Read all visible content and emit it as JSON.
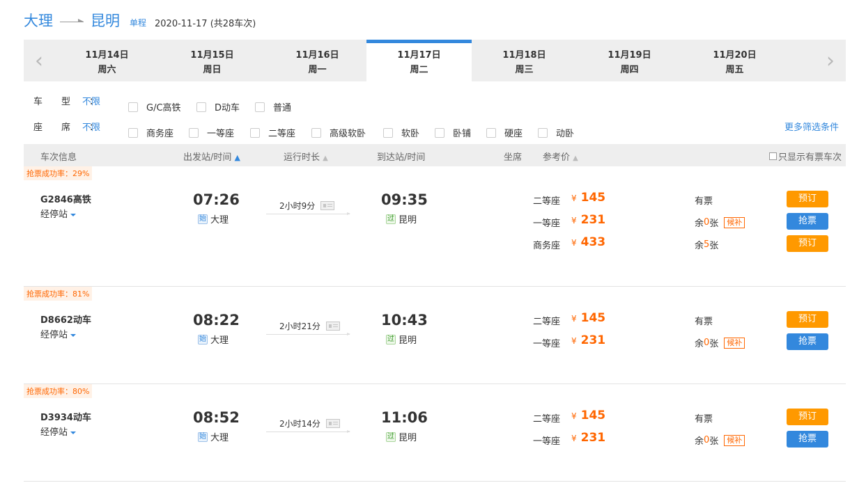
{
  "route": {
    "from": "大理",
    "to": "昆明",
    "trip_type": "单程",
    "date_summary": "2020-11-17 (共28车次)"
  },
  "date_tabs": [
    {
      "date": "11月14日",
      "weekday": "周六"
    },
    {
      "date": "11月15日",
      "weekday": "周日"
    },
    {
      "date": "11月16日",
      "weekday": "周一"
    },
    {
      "date": "11月17日",
      "weekday": "周二"
    },
    {
      "date": "11月18日",
      "weekday": "周三"
    },
    {
      "date": "11月19日",
      "weekday": "周四"
    },
    {
      "date": "11月20日",
      "weekday": "周五"
    }
  ],
  "active_tab": 3,
  "nav": {
    "prev": "‹",
    "next": "›"
  },
  "filters": {
    "train_type_label": "车型：",
    "seat_label": "座席：",
    "any": "不限",
    "train_types": [
      "G/C高铁",
      "D动车",
      "普通"
    ],
    "seats": [
      "商务座",
      "一等座",
      "二等座",
      "高级软卧",
      "软卧",
      "卧铺",
      "硬座",
      "动卧"
    ],
    "more": "更多筛选条件"
  },
  "table_header": {
    "train_info": "车次信息",
    "depart": "出发站/时间",
    "duration": "运行时长",
    "arrive": "到达站/时间",
    "seat": "坐席",
    "price": "参考价",
    "only_available": "只显示有票车次"
  },
  "labels": {
    "stops": "经停站",
    "start_tag": "始",
    "pass_tag": "过",
    "book": "预订",
    "grab": "抢票",
    "waitlist": "候补",
    "yen": "¥"
  },
  "trains": [
    {
      "rate": "抢票成功率：29%",
      "code": "G2846高铁",
      "depart_time": "07:26",
      "depart_station": "大理",
      "duration": "2小时9分",
      "arrive_time": "09:35",
      "arrive_station": "昆明",
      "seats": [
        {
          "name": "二等座",
          "price": "145",
          "avail_pre": "有票",
          "avail_num": "",
          "avail_post": "",
          "waitlist": false,
          "action": "book"
        },
        {
          "name": "一等座",
          "price": "231",
          "avail_pre": "余",
          "avail_num": "0",
          "avail_post": "张",
          "waitlist": true,
          "action": "grab"
        },
        {
          "name": "商务座",
          "price": "433",
          "avail_pre": "余",
          "avail_num": "5",
          "avail_post": "张",
          "waitlist": false,
          "action": "book"
        }
      ]
    },
    {
      "rate": "抢票成功率：81%",
      "code": "D8662动车",
      "depart_time": "08:22",
      "depart_station": "大理",
      "duration": "2小时21分",
      "arrive_time": "10:43",
      "arrive_station": "昆明",
      "seats": [
        {
          "name": "二等座",
          "price": "145",
          "avail_pre": "有票",
          "avail_num": "",
          "avail_post": "",
          "waitlist": false,
          "action": "book"
        },
        {
          "name": "一等座",
          "price": "231",
          "avail_pre": "余",
          "avail_num": "0",
          "avail_post": "张",
          "waitlist": true,
          "action": "grab"
        }
      ]
    },
    {
      "rate": "抢票成功率：80%",
      "code": "D3934动车",
      "depart_time": "08:52",
      "depart_station": "大理",
      "duration": "2小时14分",
      "arrive_time": "11:06",
      "arrive_station": "昆明",
      "seats": [
        {
          "name": "二等座",
          "price": "145",
          "avail_pre": "有票",
          "avail_num": "",
          "avail_post": "",
          "waitlist": false,
          "action": "book"
        },
        {
          "name": "一等座",
          "price": "231",
          "avail_pre": "余",
          "avail_num": "0",
          "avail_post": "张",
          "waitlist": true,
          "action": "grab"
        }
      ]
    }
  ],
  "colors": {
    "accent": "#3388dd",
    "price": "#ff6600",
    "book_button": "#ff9900",
    "grab_button": "#3388dd"
  }
}
